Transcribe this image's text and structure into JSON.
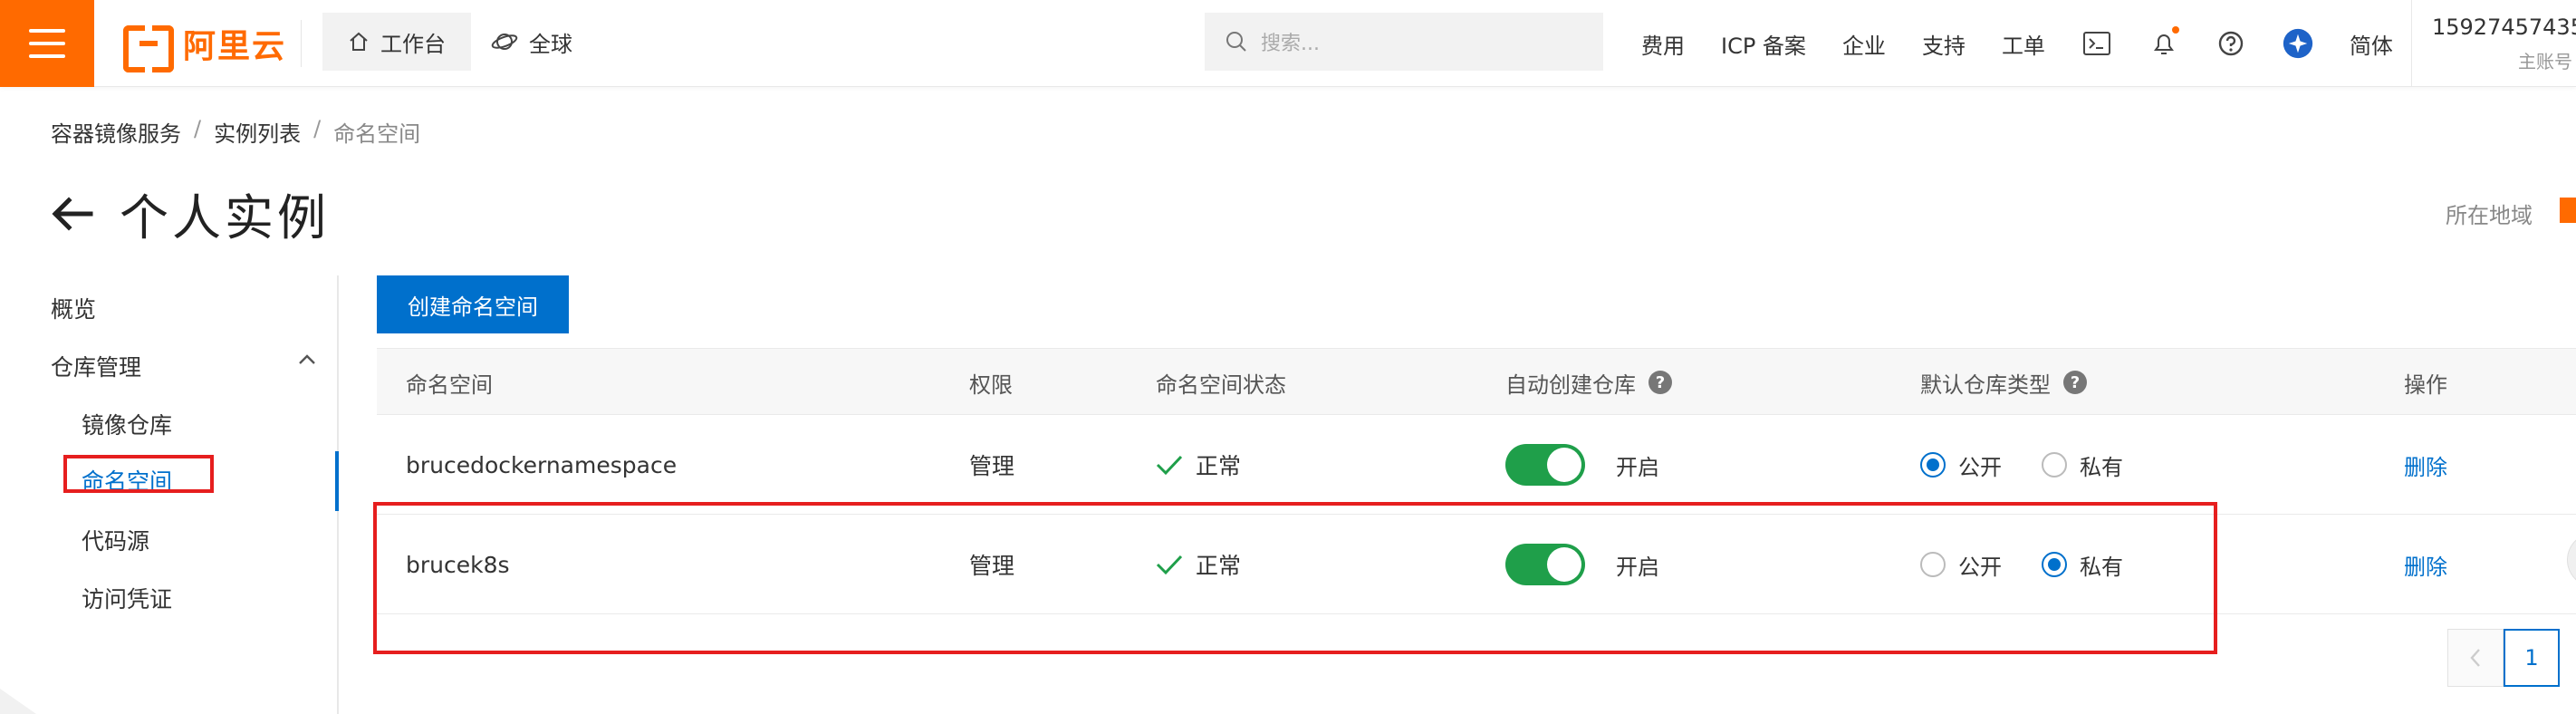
{
  "topbar": {
    "logo_text": "阿里云",
    "workbench_label": "工作台",
    "global_label": "全球",
    "search_placeholder": "搜索...",
    "nav": [
      "费用",
      "ICP 备案",
      "企业",
      "支持",
      "工单"
    ],
    "lang_label": "简体",
    "user_phone": "15927457435",
    "user_role": "主账号",
    "accent_color": "#ff6a00"
  },
  "breadcrumb": {
    "items": [
      "容器镜像服务",
      "实例列表",
      "命名空间"
    ],
    "separator": "/"
  },
  "page": {
    "title": "个人实例",
    "region_label": "所在地域"
  },
  "sidebar": {
    "overview": "概览",
    "repo_mgmt": "仓库管理",
    "items": [
      "镜像仓库",
      "命名空间",
      "代码源",
      "访问凭证"
    ],
    "active_item": "命名空间"
  },
  "main": {
    "create_button": "创建命名空间",
    "columns": [
      "命名空间",
      "权限",
      "命名空间状态",
      "自动创建仓库",
      "默认仓库类型",
      "操作"
    ],
    "rows": [
      {
        "namespace": "brucedockernamespace",
        "permission": "管理",
        "status": "正常",
        "auto_create": "开启",
        "auto_create_on": true,
        "repo_type_public": "公开",
        "repo_type_private": "私有",
        "selected_repo_type": "公开",
        "action": "删除"
      },
      {
        "namespace": "brucek8s",
        "permission": "管理",
        "status": "正常",
        "auto_create": "开启",
        "auto_create_on": true,
        "repo_type_public": "公开",
        "repo_type_private": "私有",
        "selected_repo_type": "私有",
        "action": "删除"
      }
    ],
    "pagination": {
      "current_page": "1"
    },
    "link_color": "#0070cc",
    "toggle_color": "#1f9f4a",
    "highlight_color": "#e61e1e"
  }
}
